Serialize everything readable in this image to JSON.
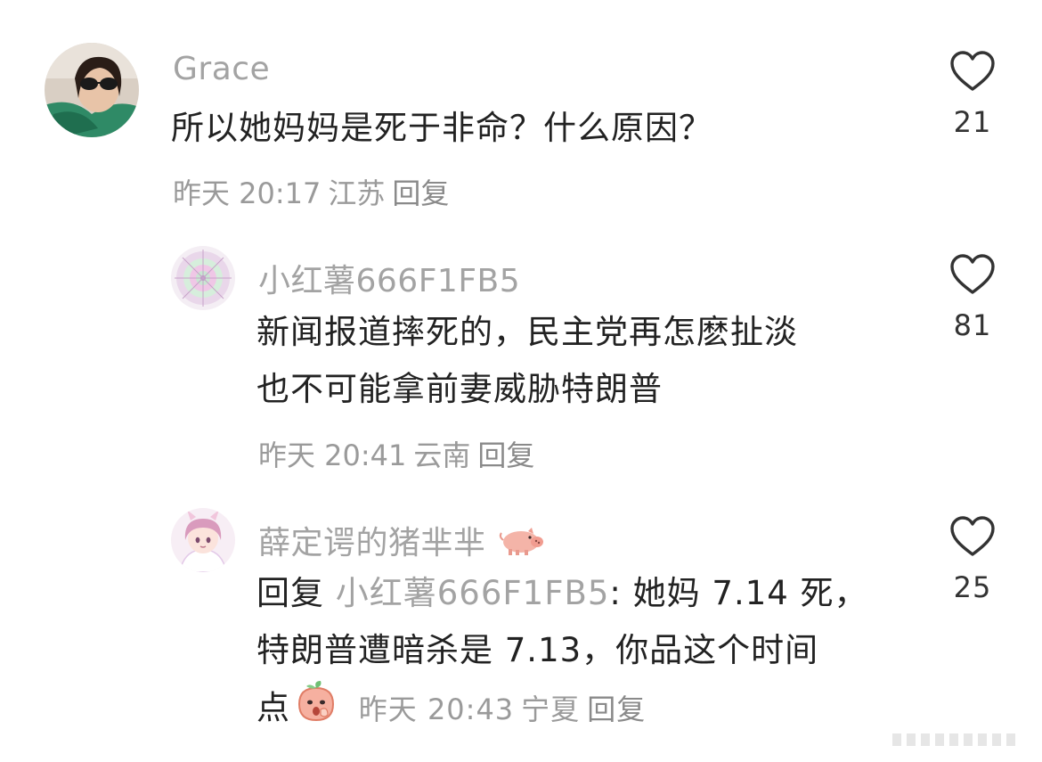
{
  "comments": [
    {
      "username": "Grace",
      "content": "所以她妈妈是死于非命？什么原因？",
      "time": "昨天 20:17",
      "location": "江苏",
      "reply_label": "回复",
      "likes": "21"
    },
    {
      "username": "小红薯666F1FB5",
      "content_line1": "新闻报道摔死的，民主党再怎麽扯淡",
      "content_line2": "也不可能拿前妻威胁特朗普",
      "time": "昨天 20:41",
      "location": "云南",
      "reply_label": "回复",
      "likes": "81"
    },
    {
      "username": "薛定谔的猪芈芈",
      "username_emoji": "pig-emoji",
      "reply_prefix": "回复",
      "reply_target": "小红薯666F1FB5",
      "content_line1": ": 她妈 7.14 死，",
      "content_line2": "特朗普遭暗杀是 7.13，你品这个时间",
      "content_line3": "点",
      "content_emoji": "thinking-peach-emoji",
      "time": "昨天 20:43",
      "location": "宁夏",
      "reply_label": "回复",
      "likes": "25"
    }
  ],
  "colors": {
    "text": "#222222",
    "muted": "#a3a3a3",
    "icon": "#333333"
  }
}
